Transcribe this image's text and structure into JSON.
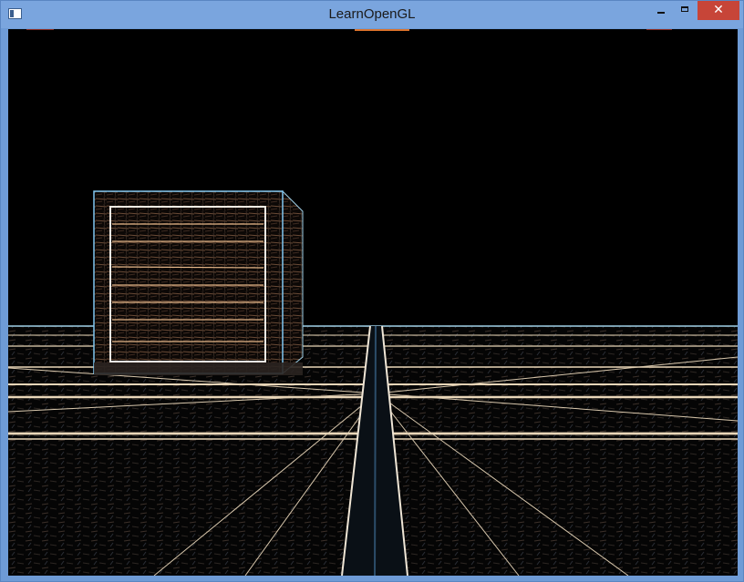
{
  "window": {
    "title": "LearnOpenGL",
    "close_label": "✕"
  },
  "icons": {
    "app": "window-app-icon",
    "minimize": "minimize-icon",
    "maximize": "maximize-icon",
    "close": "close-icon"
  },
  "colors": {
    "titlebar": "#7aa5de",
    "close_button": "#c74538",
    "viewport_background": "#000000"
  }
}
